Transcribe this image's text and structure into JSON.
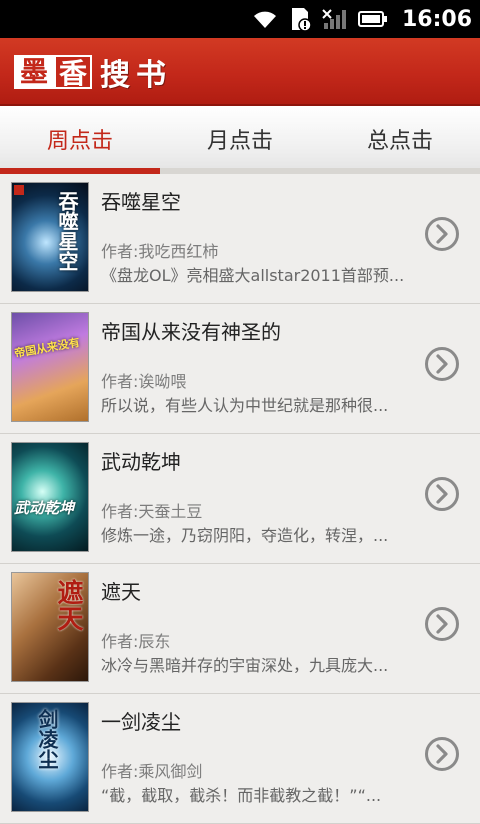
{
  "status_bar": {
    "time": "16:06"
  },
  "header": {
    "logo_left": "墨",
    "logo_right": "香",
    "logo_text": "搜书"
  },
  "tabs": [
    {
      "label": "周点击",
      "active": true
    },
    {
      "label": "月点击",
      "active": false
    },
    {
      "label": "总点击",
      "active": false
    }
  ],
  "colors": {
    "accent": "#c3281a",
    "background": "#efeeec"
  },
  "books": [
    {
      "title": "吞噬星空",
      "author": "作者:我吃西红柿",
      "desc": "《盘龙OL》亮相盛大allstar2011首部预...",
      "cover_title": "吞噬星空"
    },
    {
      "title": "帝国从来没有神圣的",
      "author": "作者:诶呦喂",
      "desc": "所以说，有些人认为中世纪就是那种很...",
      "cover_title": "帝国从来没有"
    },
    {
      "title": "武动乾坤",
      "author": "作者:天蚕土豆",
      "desc": "修炼一途，乃窃阴阳，夺造化，转涅，...",
      "cover_title": "武动乾坤"
    },
    {
      "title": "遮天",
      "author": "作者:辰东",
      "desc": "冰冷与黑暗并存的宇宙深处，九具庞大...",
      "cover_title": "遮天"
    },
    {
      "title": "一剑凌尘",
      "author": "作者:乘风御剑",
      "desc": "“截，截取，截杀！而非截教之截！”“...",
      "cover_title": "剑凌尘"
    }
  ]
}
